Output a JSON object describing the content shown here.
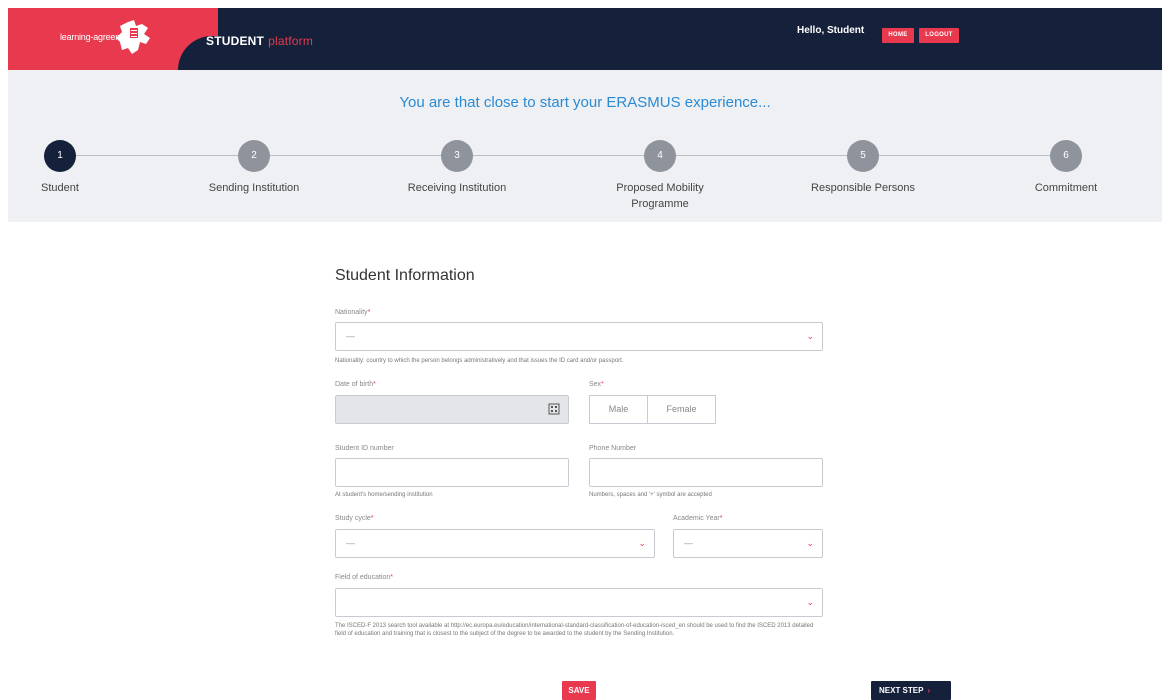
{
  "header": {
    "logo_text": "learning-agreement.eu",
    "brand_main": "STUDENT",
    "brand_sub": "platform",
    "greeting": "Hello, Student",
    "home_label": "HOME",
    "logout_label": "LOGOUT"
  },
  "steps_band": {
    "tagline": "You are that close to start your ERASMUS experience...",
    "current_step": 1,
    "steps": [
      {
        "num": "1",
        "label": "Student"
      },
      {
        "num": "2",
        "label": "Sending Institution"
      },
      {
        "num": "3",
        "label": "Receiving Institution"
      },
      {
        "num": "4",
        "label": "Proposed Mobility Programme"
      },
      {
        "num": "5",
        "label": "Responsible Persons"
      },
      {
        "num": "6",
        "label": "Commitment"
      }
    ]
  },
  "form": {
    "title": "Student Information",
    "nationality": {
      "label": "Nationality",
      "value": "—",
      "help": "Nationality: country to which the person belongs administratively and that issues the ID card and/or passport."
    },
    "dob": {
      "label": "Date of birth"
    },
    "sex": {
      "label": "Sex",
      "options": [
        "Male",
        "Female"
      ]
    },
    "student_id": {
      "label": "Student ID number",
      "help": "At student's home/sending institution"
    },
    "phone": {
      "label": "Phone Number",
      "help": "Numbers, spaces and '+' symbol are accepted"
    },
    "study_cycle": {
      "label": "Study cycle",
      "value": "—"
    },
    "academic_year": {
      "label": "Academic Year",
      "value": "—"
    },
    "field_of_education": {
      "label": "Field of education",
      "help": "The ISCED-F 2013 search tool available at http://ec.europa.eu/education/international-standard-classification-of-education-isced_en should be used to find the ISCED 2013 detailed field of education and training that is closest to the subject of the degree to be awarded to the student by the Sending Institution."
    },
    "required_mark": "*"
  },
  "actions": {
    "save_label": "SAVE",
    "next_label": "NEXT STEP",
    "next_arrow": "›"
  },
  "colors": {
    "navy": "#15203b",
    "accent": "#e8394f",
    "tagline": "#2a8ad4",
    "band": "#eef0f3"
  }
}
